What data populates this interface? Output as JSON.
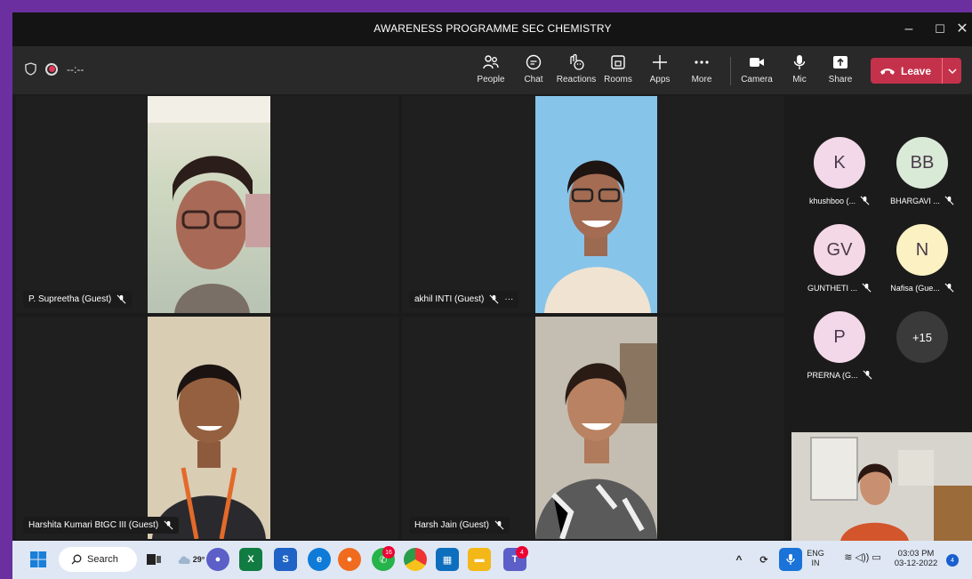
{
  "window": {
    "title": "AWARENESS PROGRAMME SEC CHEMISTRY",
    "minimize": "–",
    "maximize": "☐",
    "close": "✕"
  },
  "toolbar": {
    "timer": "--:--",
    "buttons": [
      {
        "label": "People",
        "icon": "people-icon"
      },
      {
        "label": "Chat",
        "icon": "chat-icon"
      },
      {
        "label": "Reactions",
        "icon": "reactions-icon"
      },
      {
        "label": "Rooms",
        "icon": "rooms-icon"
      },
      {
        "label": "Apps",
        "icon": "apps-icon"
      },
      {
        "label": "More",
        "icon": "more-icon"
      },
      {
        "label": "Camera",
        "icon": "camera-icon"
      },
      {
        "label": "Mic",
        "icon": "mic-icon"
      },
      {
        "label": "Share",
        "icon": "share-icon"
      }
    ],
    "leave_label": "Leave"
  },
  "tiles": [
    {
      "name": "P. Supreetha (Guest)"
    },
    {
      "name": "akhil INTI (Guest)",
      "more": "···"
    },
    {
      "name": "Harshita Kumari BtGC III (Guest)"
    },
    {
      "name": "Harsh Jain (Guest)"
    }
  ],
  "participants": [
    {
      "initials": "K",
      "name": "khushboo (...",
      "color": "#f2d8e8"
    },
    {
      "initials": "BB",
      "name": "BHARGAVI ...",
      "color": "#d9ead7"
    },
    {
      "initials": "GV",
      "name": "GUNTHETI ...",
      "color": "#f5d8e6"
    },
    {
      "initials": "N",
      "name": "Nafisa (Gue...",
      "color": "#fbf1c2"
    },
    {
      "initials": "P",
      "name": "PRERNA (G...",
      "color": "#f2d8e8"
    }
  ],
  "overflow_count": "+15",
  "taskbar": {
    "search_label": "Search",
    "weather": "29°",
    "chrome_badge": "16",
    "teams_badge": "4",
    "lang_top": "ENG",
    "lang_bottom": "IN",
    "time": "03:03 PM",
    "date": "03-12-2022",
    "notifications": "4"
  }
}
